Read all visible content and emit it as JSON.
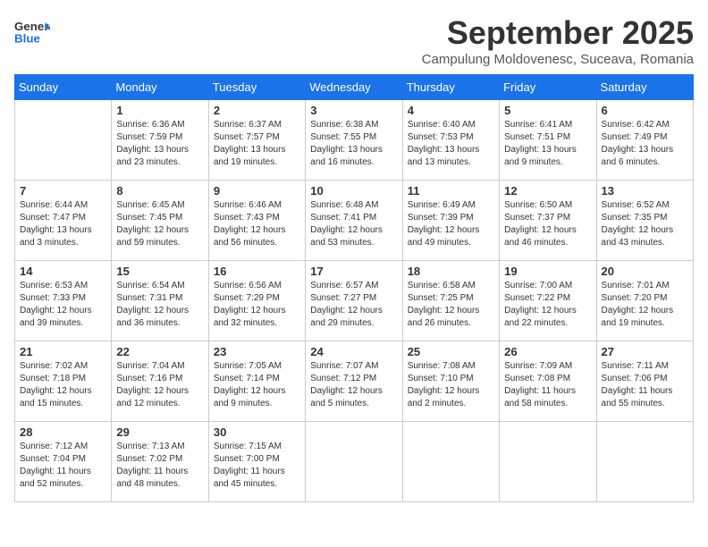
{
  "header": {
    "logo": {
      "general": "General",
      "blue": "Blue"
    },
    "month_title": "September 2025",
    "subtitle": "Campulung Moldovenesc, Suceava, Romania"
  },
  "weekdays": [
    "Sunday",
    "Monday",
    "Tuesday",
    "Wednesday",
    "Thursday",
    "Friday",
    "Saturday"
  ],
  "weeks": [
    [
      {
        "day": "",
        "info": ""
      },
      {
        "day": "1",
        "info": "Sunrise: 6:36 AM\nSunset: 7:59 PM\nDaylight: 13 hours\nand 23 minutes."
      },
      {
        "day": "2",
        "info": "Sunrise: 6:37 AM\nSunset: 7:57 PM\nDaylight: 13 hours\nand 19 minutes."
      },
      {
        "day": "3",
        "info": "Sunrise: 6:38 AM\nSunset: 7:55 PM\nDaylight: 13 hours\nand 16 minutes."
      },
      {
        "day": "4",
        "info": "Sunrise: 6:40 AM\nSunset: 7:53 PM\nDaylight: 13 hours\nand 13 minutes."
      },
      {
        "day": "5",
        "info": "Sunrise: 6:41 AM\nSunset: 7:51 PM\nDaylight: 13 hours\nand 9 minutes."
      },
      {
        "day": "6",
        "info": "Sunrise: 6:42 AM\nSunset: 7:49 PM\nDaylight: 13 hours\nand 6 minutes."
      }
    ],
    [
      {
        "day": "7",
        "info": "Sunrise: 6:44 AM\nSunset: 7:47 PM\nDaylight: 13 hours\nand 3 minutes."
      },
      {
        "day": "8",
        "info": "Sunrise: 6:45 AM\nSunset: 7:45 PM\nDaylight: 12 hours\nand 59 minutes."
      },
      {
        "day": "9",
        "info": "Sunrise: 6:46 AM\nSunset: 7:43 PM\nDaylight: 12 hours\nand 56 minutes."
      },
      {
        "day": "10",
        "info": "Sunrise: 6:48 AM\nSunset: 7:41 PM\nDaylight: 12 hours\nand 53 minutes."
      },
      {
        "day": "11",
        "info": "Sunrise: 6:49 AM\nSunset: 7:39 PM\nDaylight: 12 hours\nand 49 minutes."
      },
      {
        "day": "12",
        "info": "Sunrise: 6:50 AM\nSunset: 7:37 PM\nDaylight: 12 hours\nand 46 minutes."
      },
      {
        "day": "13",
        "info": "Sunrise: 6:52 AM\nSunset: 7:35 PM\nDaylight: 12 hours\nand 43 minutes."
      }
    ],
    [
      {
        "day": "14",
        "info": "Sunrise: 6:53 AM\nSunset: 7:33 PM\nDaylight: 12 hours\nand 39 minutes."
      },
      {
        "day": "15",
        "info": "Sunrise: 6:54 AM\nSunset: 7:31 PM\nDaylight: 12 hours\nand 36 minutes."
      },
      {
        "day": "16",
        "info": "Sunrise: 6:56 AM\nSunset: 7:29 PM\nDaylight: 12 hours\nand 32 minutes."
      },
      {
        "day": "17",
        "info": "Sunrise: 6:57 AM\nSunset: 7:27 PM\nDaylight: 12 hours\nand 29 minutes."
      },
      {
        "day": "18",
        "info": "Sunrise: 6:58 AM\nSunset: 7:25 PM\nDaylight: 12 hours\nand 26 minutes."
      },
      {
        "day": "19",
        "info": "Sunrise: 7:00 AM\nSunset: 7:22 PM\nDaylight: 12 hours\nand 22 minutes."
      },
      {
        "day": "20",
        "info": "Sunrise: 7:01 AM\nSunset: 7:20 PM\nDaylight: 12 hours\nand 19 minutes."
      }
    ],
    [
      {
        "day": "21",
        "info": "Sunrise: 7:02 AM\nSunset: 7:18 PM\nDaylight: 12 hours\nand 15 minutes."
      },
      {
        "day": "22",
        "info": "Sunrise: 7:04 AM\nSunset: 7:16 PM\nDaylight: 12 hours\nand 12 minutes."
      },
      {
        "day": "23",
        "info": "Sunrise: 7:05 AM\nSunset: 7:14 PM\nDaylight: 12 hours\nand 9 minutes."
      },
      {
        "day": "24",
        "info": "Sunrise: 7:07 AM\nSunset: 7:12 PM\nDaylight: 12 hours\nand 5 minutes."
      },
      {
        "day": "25",
        "info": "Sunrise: 7:08 AM\nSunset: 7:10 PM\nDaylight: 12 hours\nand 2 minutes."
      },
      {
        "day": "26",
        "info": "Sunrise: 7:09 AM\nSunset: 7:08 PM\nDaylight: 11 hours\nand 58 minutes."
      },
      {
        "day": "27",
        "info": "Sunrise: 7:11 AM\nSunset: 7:06 PM\nDaylight: 11 hours\nand 55 minutes."
      }
    ],
    [
      {
        "day": "28",
        "info": "Sunrise: 7:12 AM\nSunset: 7:04 PM\nDaylight: 11 hours\nand 52 minutes."
      },
      {
        "day": "29",
        "info": "Sunrise: 7:13 AM\nSunset: 7:02 PM\nDaylight: 11 hours\nand 48 minutes."
      },
      {
        "day": "30",
        "info": "Sunrise: 7:15 AM\nSunset: 7:00 PM\nDaylight: 11 hours\nand 45 minutes."
      },
      {
        "day": "",
        "info": ""
      },
      {
        "day": "",
        "info": ""
      },
      {
        "day": "",
        "info": ""
      },
      {
        "day": "",
        "info": ""
      }
    ]
  ]
}
